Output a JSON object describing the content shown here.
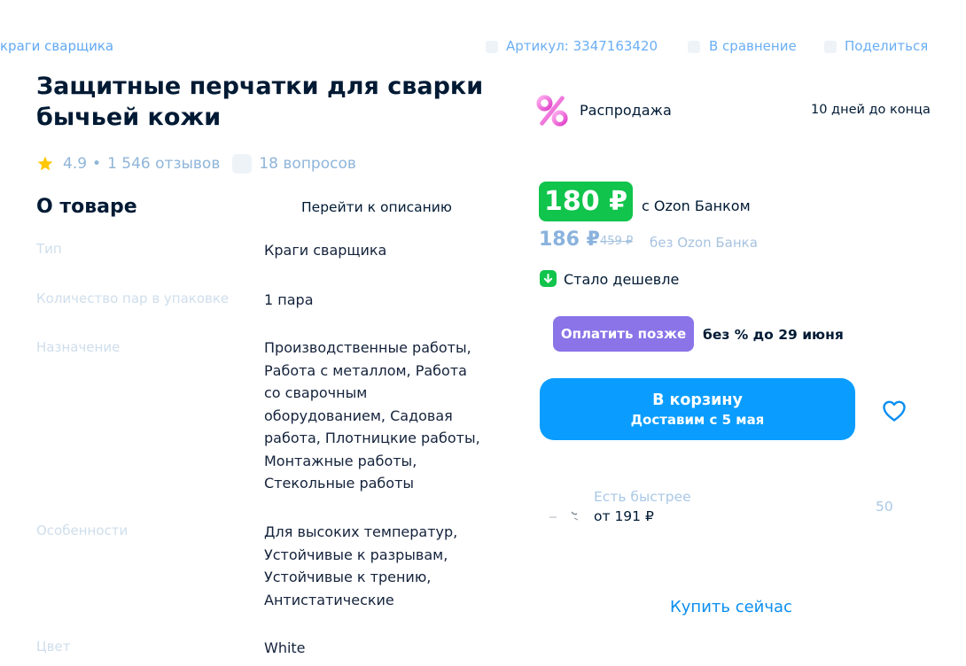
{
  "breadcrumb": {
    "current": "краги сварщика"
  },
  "header_meta": {
    "article": "Артикул: 3347163420",
    "compare": "В сравнение",
    "share": "Поделиться"
  },
  "product": {
    "title": "Защитные перчатки для сварки бычьей кожи",
    "rating": "4.9",
    "separator": "•",
    "reviews": "1 546 отзывов",
    "questions": "18 вопросов"
  },
  "about": {
    "heading": "О товаре",
    "go_to_description": "Перейти к описанию",
    "specs": [
      {
        "key": "Тип",
        "value": "Краги сварщика"
      },
      {
        "key": "Количество пар в упаковке",
        "value": "1 пара"
      },
      {
        "key": "Назначение",
        "value": "Производственные работы, Работа с металлом, Работа со сварочным оборудованием, Садовая работа, Плотницкие работы, Монтажные работы, Стекольные работы"
      },
      {
        "key": "Особенности",
        "value": "Для высоких температур, Устойчивые к разрывам, Устойчивые к трению, Антистатические"
      },
      {
        "key": "Цвет",
        "value": "White"
      }
    ]
  },
  "offer": {
    "sale_label": "Распродажа",
    "sale_ends": "10 дней до конца",
    "price_bank": "180 ₽",
    "price_bank_note": "с Ozon Банком",
    "price_regular": "186 ₽",
    "price_old": "459 ₽",
    "price_regular_note": "без Ozon Банка",
    "cheaper": "Стало дешевле",
    "pay_later_button": "Оплатить позже",
    "pay_later_note": "без % до 29 июня",
    "cart_button": "В корзину",
    "cart_delivery": "Доставим с 5 мая",
    "faster_title": "Есть быстрее",
    "faster_price": "от 191 ₽",
    "faster_count": "50",
    "buy_now": "Купить сейчас"
  },
  "colors": {
    "accent_blue": "#0a9dff",
    "price_green": "#10c44c",
    "pay_later_purple": "#8a74e8",
    "text_dark": "#001a34"
  }
}
